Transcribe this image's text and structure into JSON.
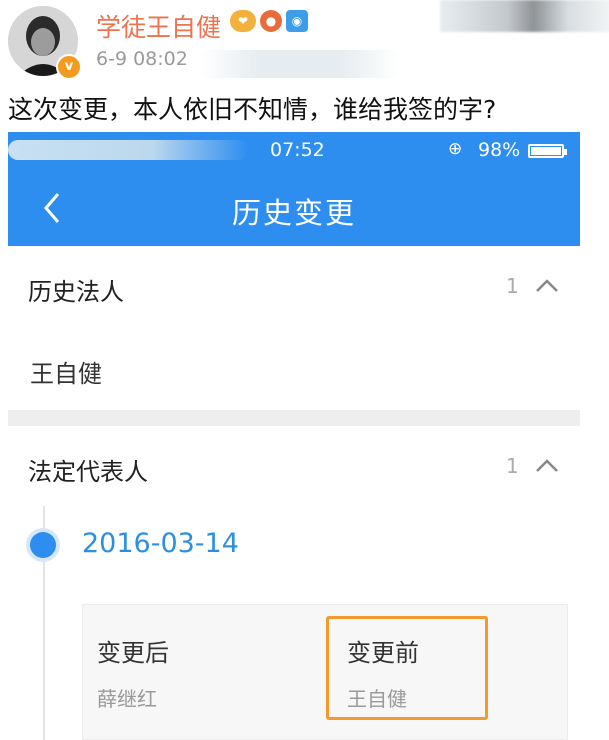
{
  "post": {
    "username": "学徒王自健",
    "time": "6-9 08:02",
    "text": "这次变更，本人依旧不知情，谁给我签的字?",
    "badge_icons": [
      "fan-badge-icon",
      "vip-badge-icon",
      "camera-badge-icon"
    ]
  },
  "phone": {
    "status_time": "07:52",
    "battery": "98%",
    "nav_title": "历史变更",
    "accent_color": "#2e8ef0",
    "sections": [
      {
        "title": "历史法人",
        "count": "1",
        "value": "王自健"
      },
      {
        "title": "法定代表人",
        "count": "1"
      }
    ],
    "timeline": {
      "date": "2016-03-14",
      "after_label": "变更后",
      "after_value": "薛继红",
      "before_label": "变更前",
      "before_value": "王自健"
    },
    "highlight_color": "#f29a2e"
  }
}
